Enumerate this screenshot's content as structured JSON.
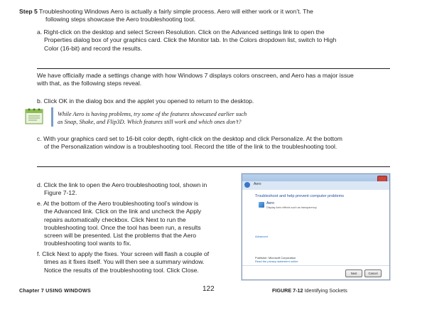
{
  "step": {
    "label": "Step 5",
    "intro_line1": "Troubleshooting Windows Aero is actually a fairly simple process. Aero will either work or it won’t. The",
    "intro_line2": "following steps showcase the Aero troubleshooting tool."
  },
  "item_a": {
    "line1": "a. Right-click on the desktop and select Screen Resolution. Click on the Advanced settings link to open the",
    "line2": "Properties dialog box of your graphics card. Click the Monitor tab. In the Colors dropdown list, switch to High",
    "line3": "Color (16-bit) and record the results."
  },
  "paragraph_colors": {
    "line1": "We have officially made a settings change with how Windows 7 displays colors onscreen, and Aero has a major issue",
    "line2": "with that, as the following steps reveal."
  },
  "item_b": "b. Click OK in the dialog box and the applet you opened to return to the desktop.",
  "note": {
    "icon": "note-pad-icon",
    "line1": "While Aero is having problems, try some of the features showcased earlier such",
    "line2": "as Snap, Shake, and Flip3D. Which features still work and which ones don’t?"
  },
  "item_c": {
    "line1": "c. With your graphics card set to 16-bit color depth, right-click on the desktop and click Personalize. At the bottom",
    "line2": "of the Personalization window is a troubleshooting tool. Record the title of the link to the troubleshooting tool."
  },
  "item_d": {
    "line1": "d. Click the link to open the Aero troubleshooting tool, shown in",
    "line2": "Figure 7-12."
  },
  "item_e": {
    "line1": "e. At the bottom of the Aero troubleshooting tool’s window is",
    "line2": "the Advanced link. Click on the link and uncheck the Apply",
    "line3": "repairs automatically checkbox. Click Next to run the",
    "line4": "troubleshooting tool. Once the tool has been run, a results",
    "line5": "screen will be presented. List the problems that the Aero",
    "line6": "troubleshooting tool wants to fix."
  },
  "item_f": {
    "line1": "f. Click Next to apply the fixes. Your screen will flash a couple of",
    "line2": "times as it fixes itself. You will then see a summary window.",
    "line3": "Notice the results of the troubleshooting tool. Click Close."
  },
  "figure": {
    "address": "Aero",
    "heading": "Troubleshoot and help prevent computer problems",
    "item_title": "Aero",
    "item_desc": "Display Aero effects such as transparency.",
    "advanced": "Advanced",
    "publisher": "Publisher: Microsoft Corporation",
    "privacy": "Read the privacy statement online",
    "next": "Next",
    "cancel": "Cancel"
  },
  "footer": {
    "chapter": "Chapter 7 USING WINDOWS",
    "page": "122",
    "figure_label": "FIGURE 7-12",
    "figure_caption": "Identifying Sockets"
  },
  "colors": {
    "text": "#231f20",
    "figure_link": "#1a6fc9",
    "note_rule": "#7c9ec8"
  }
}
